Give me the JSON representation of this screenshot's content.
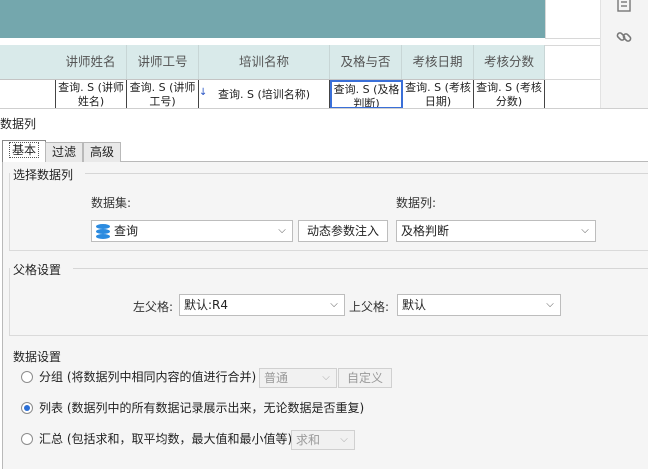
{
  "sheet": {
    "headers": [
      "讲师姓名",
      "讲师工号",
      "培训名称",
      "及格与否",
      "考核日期",
      "考核分数"
    ],
    "cells": [
      [
        "查询. S (讲师",
        "姓名)"
      ],
      [
        "查询. S (讲师",
        "工号)"
      ],
      [
        "查询. S (培训名称)"
      ],
      [
        "查询. S (及格",
        "判断)"
      ],
      [
        "查询. S (考核",
        "日期)"
      ],
      [
        "查询. S (考核",
        "分数)"
      ]
    ]
  },
  "side": {
    "icons": [
      "form-icon",
      "link-icon"
    ]
  },
  "dialog": {
    "title": "数据列",
    "tabs": [
      "基本",
      "过滤",
      "高级"
    ],
    "select_section": {
      "label": "选择数据列",
      "dataset_label": "数据集:",
      "dataset_value": "查询",
      "dynamic_param_button": "动态参数注入",
      "column_label": "数据列:",
      "column_value": "及格判断"
    },
    "parent_section": {
      "label": "父格设置",
      "left_parent_label": "左父格:",
      "left_parent_value": "默认:R4",
      "top_parent_label": "上父格:",
      "top_parent_value": "默认"
    },
    "data_section": {
      "label": "数据设置",
      "group_option": "分组 (将数据列中相同内容的值进行合并)",
      "group_mode_value": "普通",
      "custom_button": "自定义",
      "list_option": "列表 (数据列中的所有数据记录展示出来，无论数据是否重复)",
      "summary_option": "汇总 (包括求和，取平均数，最大值和最小值等)",
      "summary_mode_value": "求和",
      "selected": "list"
    }
  },
  "colors": {
    "band": "#74a7ad",
    "header": "#d9eaea",
    "selection": "#3a6fd8",
    "accent": "#2b6fd6"
  }
}
